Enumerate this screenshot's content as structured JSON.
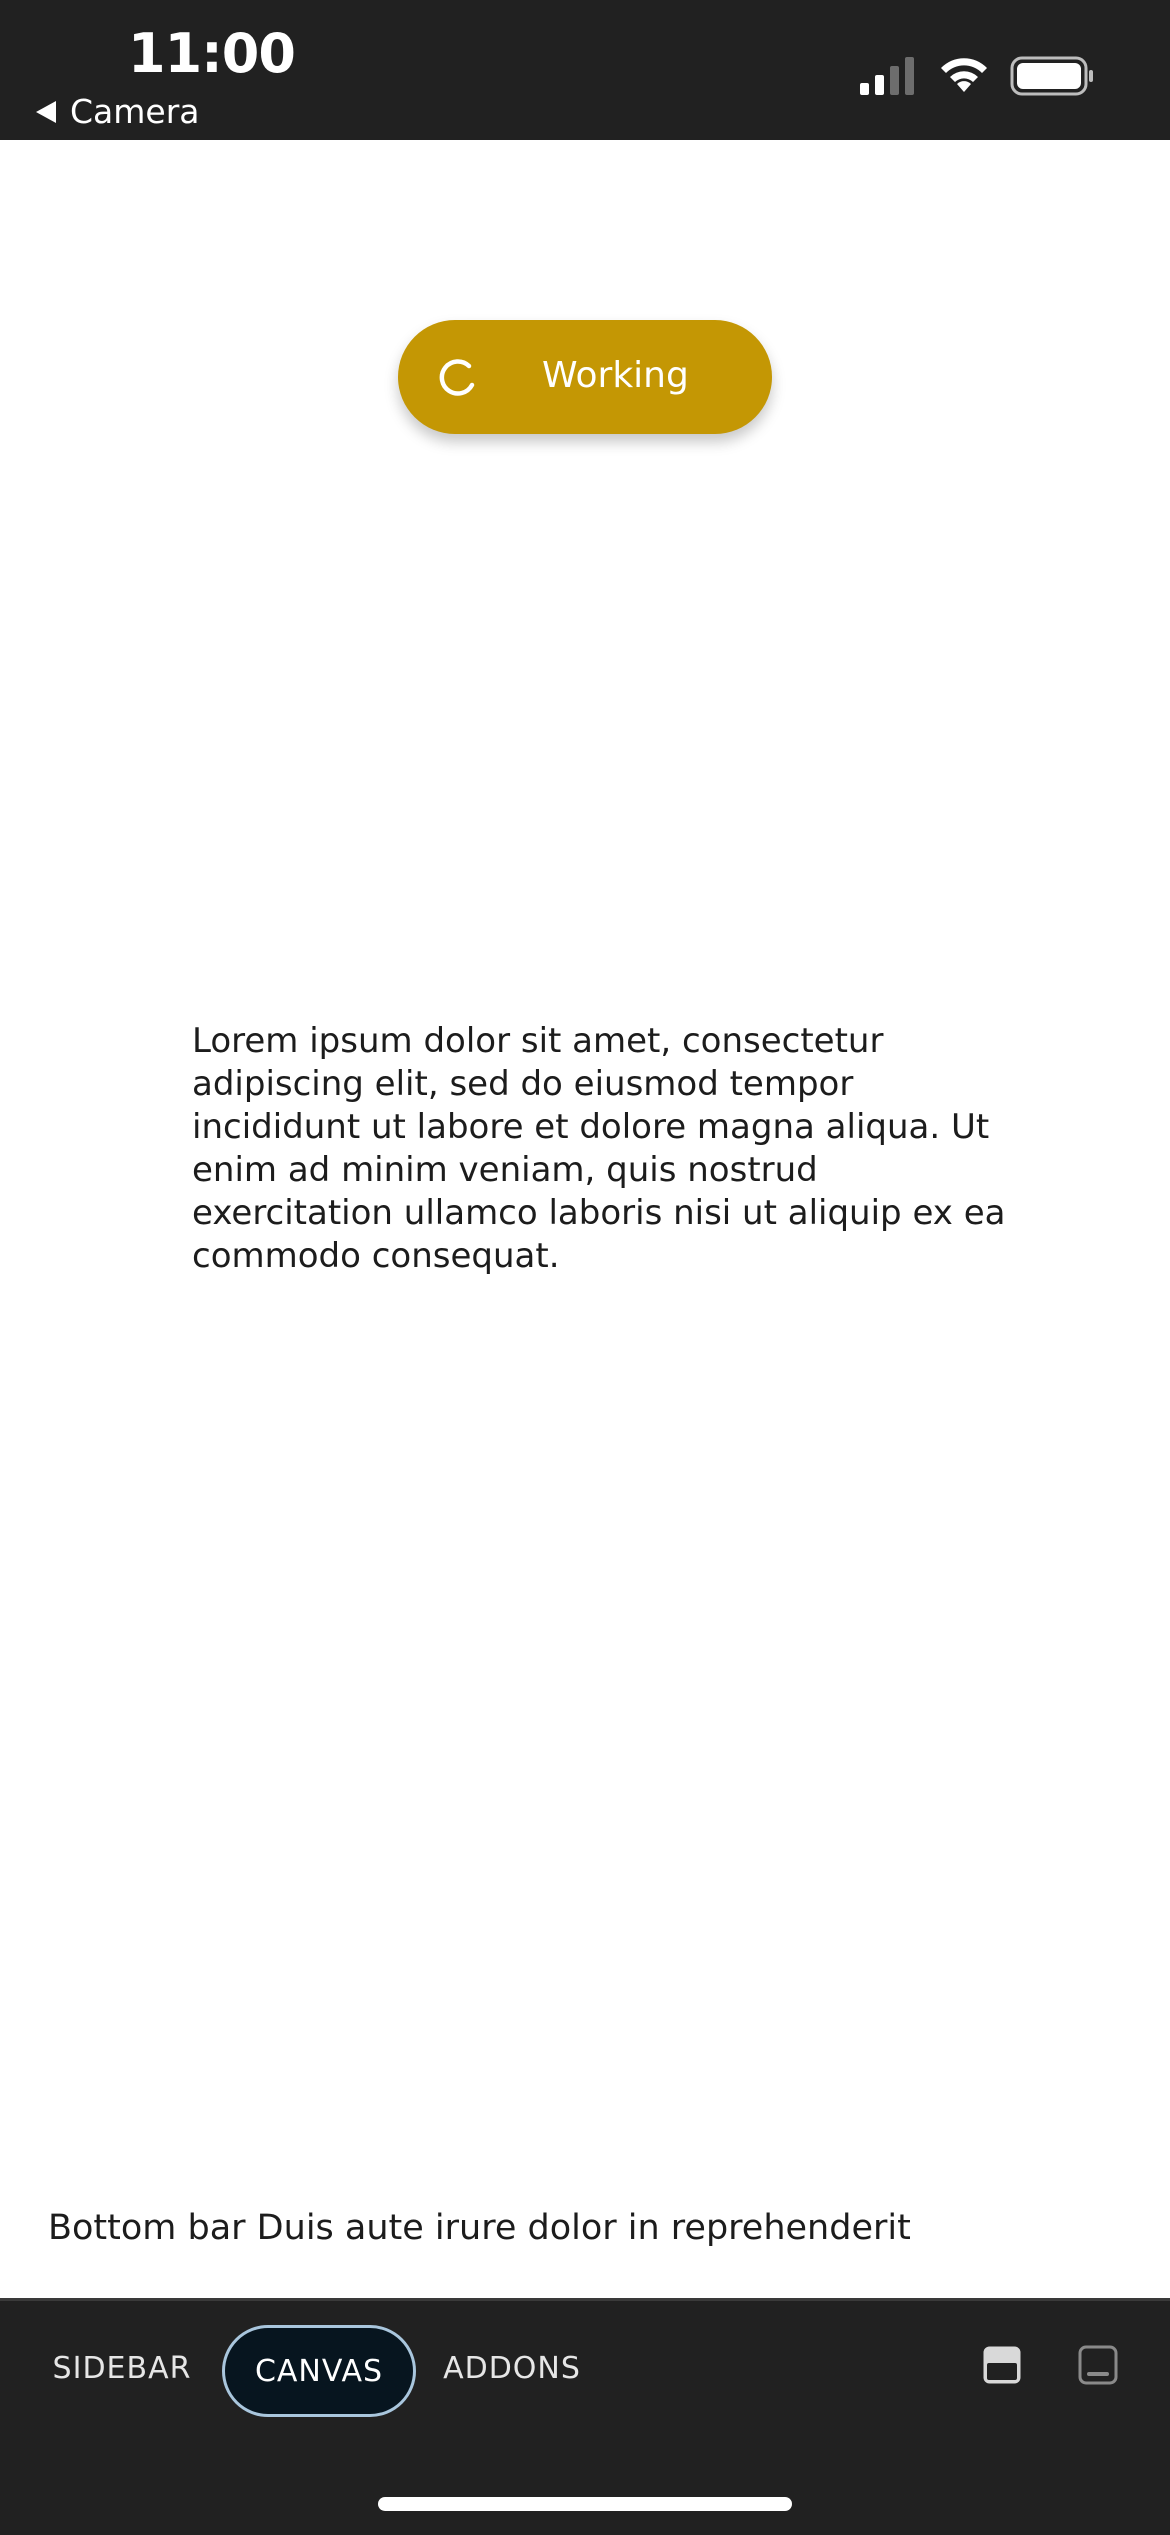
{
  "status_bar": {
    "time": "11:00",
    "back_app": "Camera",
    "icons": [
      "cellular-signal-icon",
      "wifi-icon",
      "battery-icon"
    ]
  },
  "working_indicator": {
    "label": "Working",
    "color": "#c49704",
    "icon": "spinner-icon"
  },
  "content": {
    "text": "Lorem ipsum dolor sit amet, consectetur adipiscing elit, sed do eiusmod tempor incididunt ut labore et dolore magna aliqua. Ut enim ad minim veniam, quis nostrud exercitation ullamco laboris nisi ut aliquip ex ea commodo consequat."
  },
  "bottom_bar": {
    "text": "Bottom bar Duis aute irure dolor in reprehenderit"
  },
  "toolbar": {
    "tabs": [
      {
        "label": "SIDEBAR",
        "selected": false
      },
      {
        "label": "CANVAS",
        "selected": true
      },
      {
        "label": "ADDONS",
        "selected": false
      }
    ],
    "layout_buttons": [
      "panel-top-icon",
      "panel-bottom-icon"
    ],
    "accent": "#a9c6dd"
  }
}
